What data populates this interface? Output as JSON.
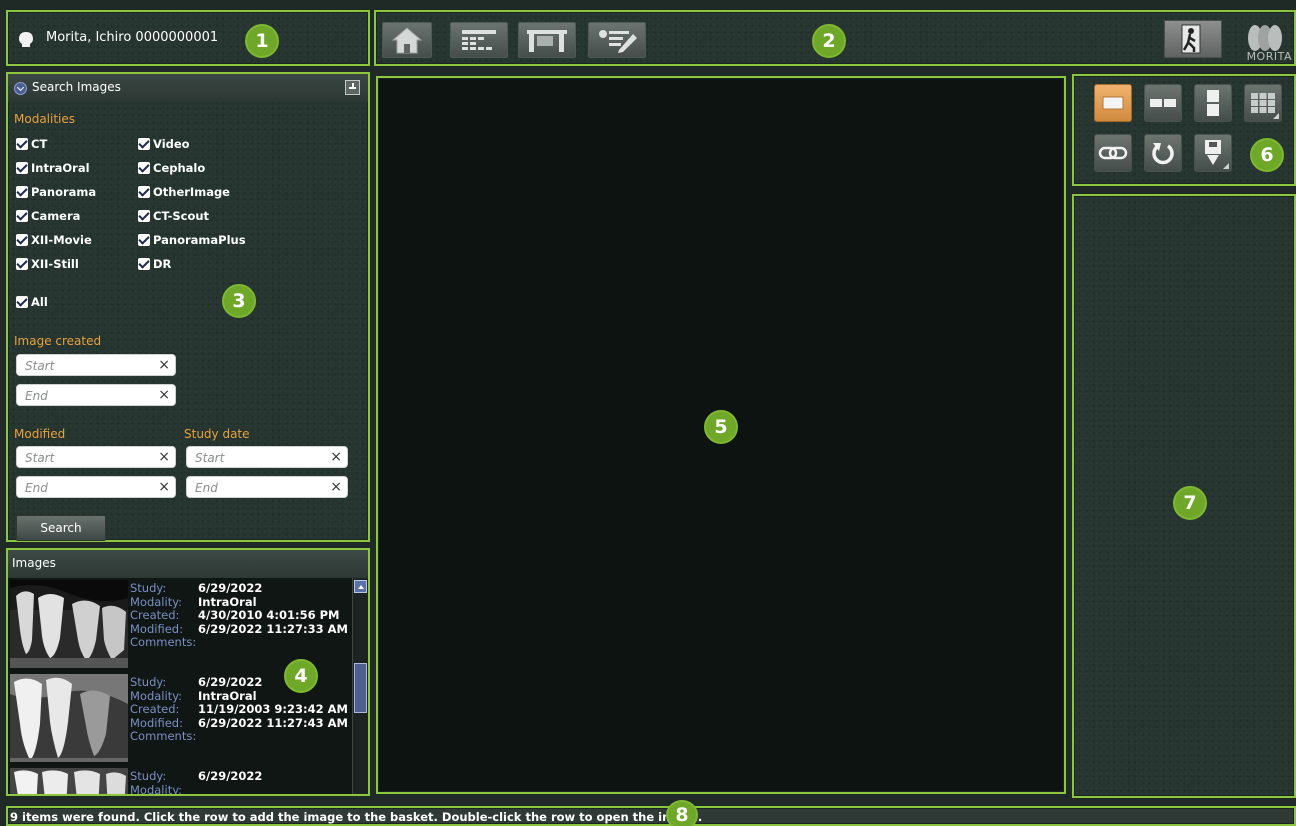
{
  "patient": {
    "name_id": "Morita, Ichiro  0000000001"
  },
  "badges": [
    "1",
    "2",
    "3",
    "4",
    "5",
    "6",
    "7",
    "8"
  ],
  "toolbar": {
    "buttons": [
      "home-icon",
      "patient-list-icon",
      "workspace-icon",
      "report-icon"
    ],
    "exit_icon": "exit-door-icon",
    "logo_text": "MORITA"
  },
  "search_panel": {
    "title": "Search Images",
    "modalities_label": "Modalities",
    "modalities": [
      {
        "label": "CT",
        "checked": true
      },
      {
        "label": "Video",
        "checked": true
      },
      {
        "label": "IntraOral",
        "checked": true
      },
      {
        "label": "Cephalo",
        "checked": true
      },
      {
        "label": "Panorama",
        "checked": true
      },
      {
        "label": "OtherImage",
        "checked": true
      },
      {
        "label": "Camera",
        "checked": true
      },
      {
        "label": "CT-Scout",
        "checked": true
      },
      {
        "label": "XII-Movie",
        "checked": true
      },
      {
        "label": "PanoramaPlus",
        "checked": true
      },
      {
        "label": "XII-Still",
        "checked": true
      },
      {
        "label": "DR",
        "checked": true
      }
    ],
    "all_label": "All",
    "image_created_label": "Image created",
    "modified_label": "Modified",
    "study_date_label": "Study date",
    "start_placeholder": "Start",
    "end_placeholder": "End",
    "clear_symbol": "×",
    "search_button": "Search"
  },
  "images_panel": {
    "title": "Images",
    "labels": {
      "study": "Study:",
      "modality": "Modality:",
      "created": "Created:",
      "modified": "Modified:",
      "comments": "Comments:"
    },
    "items": [
      {
        "study": "6/29/2022",
        "modality": "IntraOral",
        "created": "4/30/2010 4:01:56 PM",
        "modified": "6/29/2022 11:27:33 AM",
        "comments": ""
      },
      {
        "study": "6/29/2022",
        "modality": "IntraOral",
        "created": "11/19/2003 9:23:42 AM",
        "modified": "6/29/2022 11:27:43 AM",
        "comments": ""
      },
      {
        "study": "6/29/2022",
        "modality": "",
        "created": "",
        "modified": "",
        "comments": ""
      }
    ]
  },
  "view_tools": {
    "buttons": [
      "single-layout-icon",
      "two-column-layout-icon",
      "two-row-layout-icon",
      "grid-layout-icon",
      "link-icon",
      "rotate-icon",
      "save-icon"
    ]
  },
  "status_bar": {
    "text": "9 items were found. Click the row to add the image to the basket. Double-click the row to open the image."
  },
  "colors": {
    "panel_border": "#8cc63f",
    "section_label": "#e8a23e",
    "meta_label": "#7a8fc4",
    "active_button": "#e09c50"
  }
}
